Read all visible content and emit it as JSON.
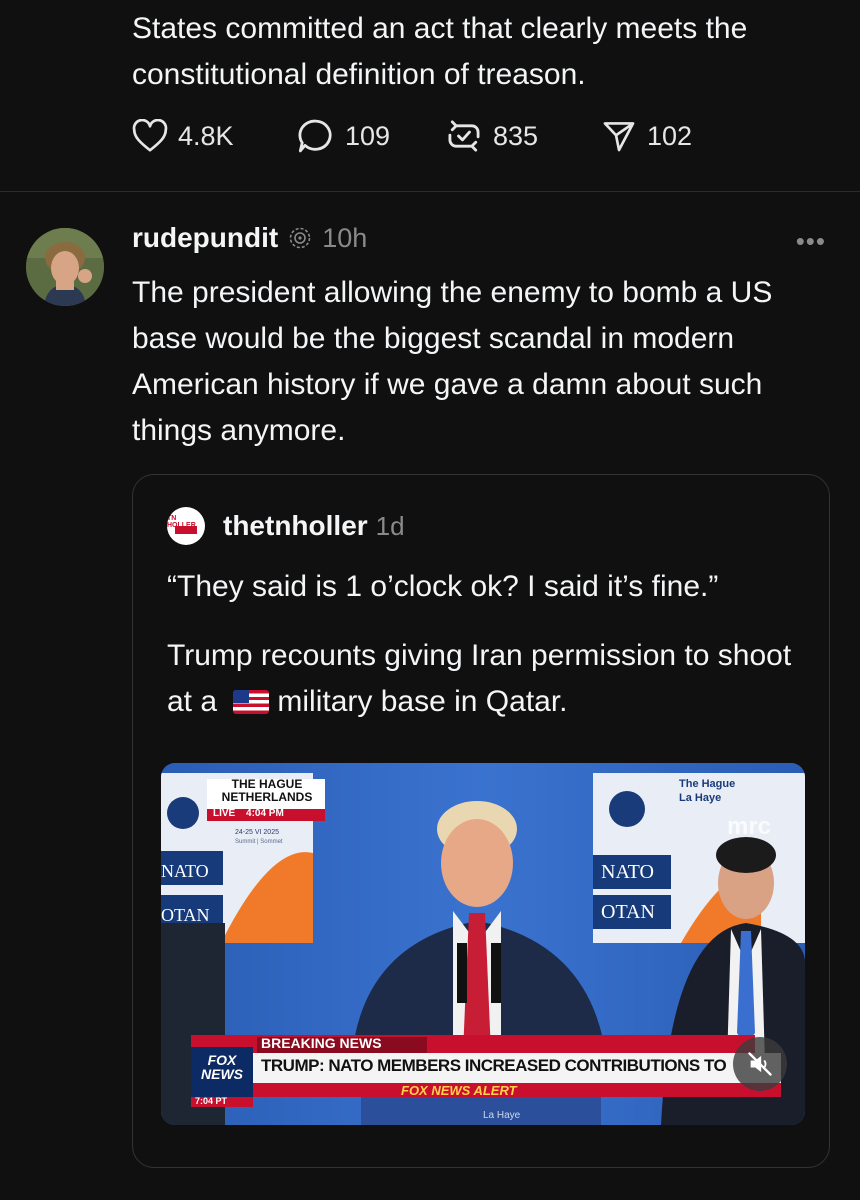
{
  "previous_post": {
    "text": "States committed an act that clearly meets the constitutional definition of treason.",
    "likes": "4.8K",
    "replies": "109",
    "reposts": "835",
    "shares": "102"
  },
  "post": {
    "username": "rudepundit",
    "time": "10h",
    "more": "•••",
    "text": "The president allowing the enemy to bomb a US base would be the biggest scandal in modern American history if we gave a damn about such things anymore."
  },
  "quoted": {
    "avatar_label": "TN HOLLER",
    "username": "thetnholler",
    "time": "1d",
    "quote": "“They said is 1 o’clock ok? I said it’s fine.”",
    "text_before": "Trump recounts giving Iran permission to shoot at a",
    "text_after": "military base in Qatar.",
    "video": {
      "location_line1": "THE HAGUE",
      "location_line2": "NETHERLANDS",
      "live": "LIVE",
      "clock": "4:04 PM",
      "summit": "24-25 VI 2025",
      "summit_sub": "Summit | Sommet",
      "nato": "NATO",
      "otan": "OTAN",
      "right_loc1": "The Hague",
      "right_loc2": "La Haye",
      "watermark": "mrc",
      "breaking": "BREAKING NEWS",
      "headline": "TRUMP: NATO MEMBERS INCREASED CONTRIBUTIONS TO",
      "network_line1": "FOX",
      "network_line2": "NEWS",
      "network_time": "7:04 PT",
      "alert": "FOX NEWS ALERT",
      "bottom_sign": "La Haye"
    }
  },
  "colors": {
    "background": "#101010",
    "text": "#f3f5f7",
    "muted": "#8a8a8a",
    "border": "#333333",
    "fox_red": "#c8102e"
  }
}
